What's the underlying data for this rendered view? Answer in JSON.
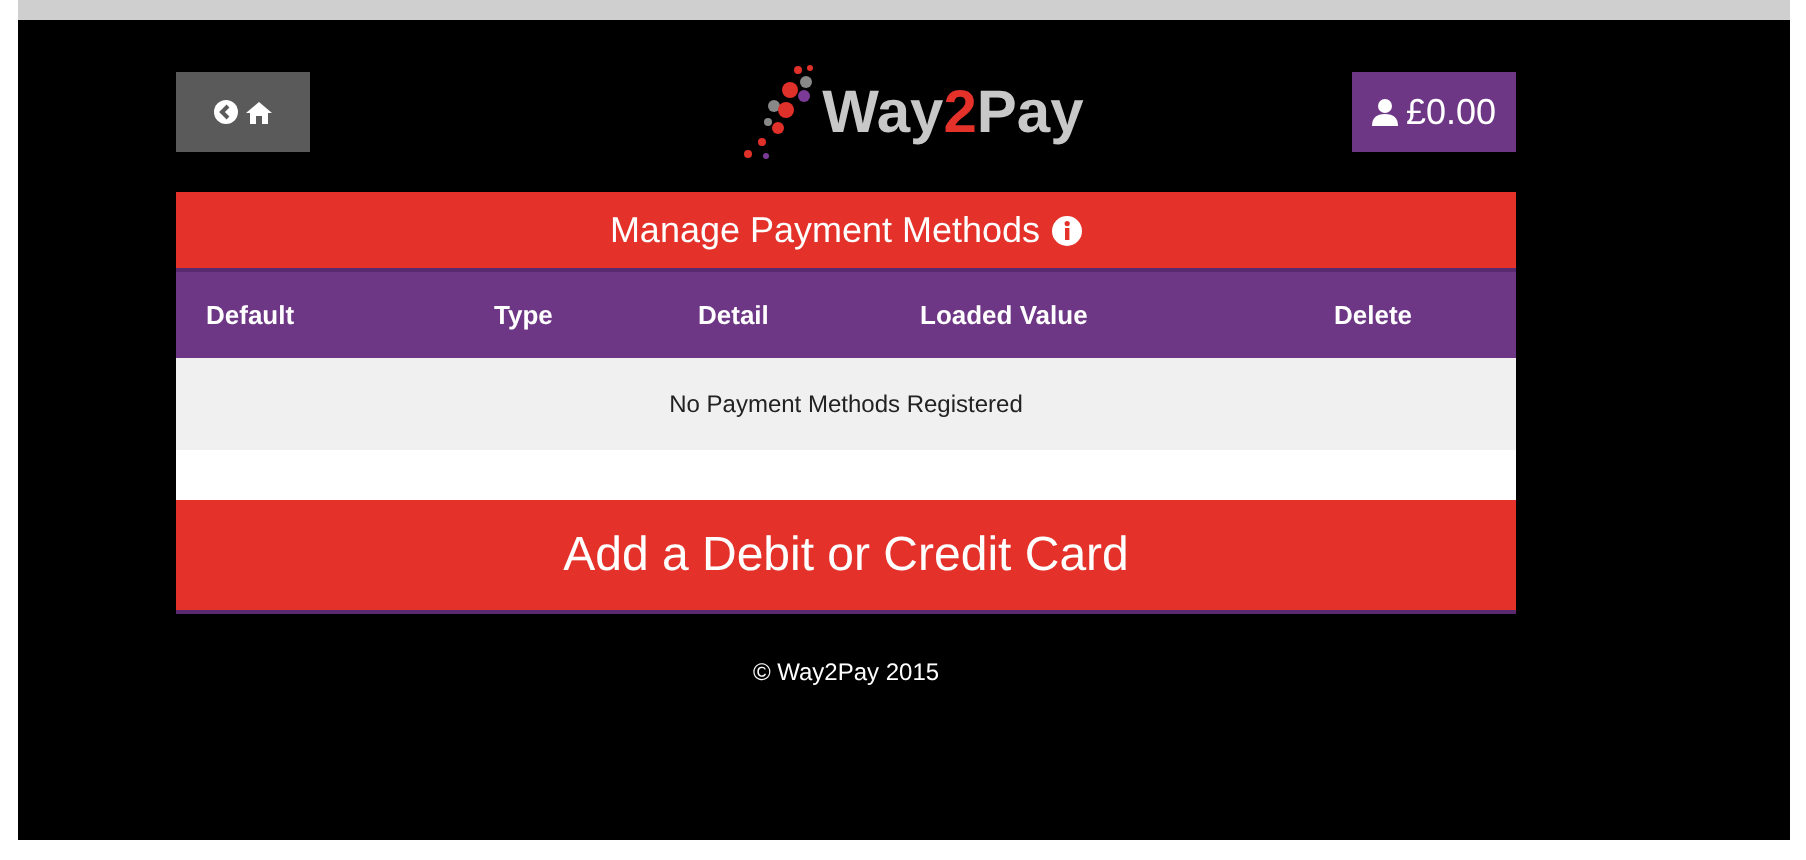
{
  "header": {
    "logo": {
      "before": "Way",
      "accent": "2",
      "after": "Pay"
    },
    "balance": "£0.00"
  },
  "panel": {
    "title": "Manage Payment Methods",
    "table": {
      "columns": [
        "Default",
        "Type",
        "Detail",
        "Loaded Value",
        "Delete"
      ],
      "empty_message": "No Payment Methods Registered"
    },
    "add_button": "Add a Debit or Credit Card"
  },
  "footer": "© Way2Pay 2015"
}
